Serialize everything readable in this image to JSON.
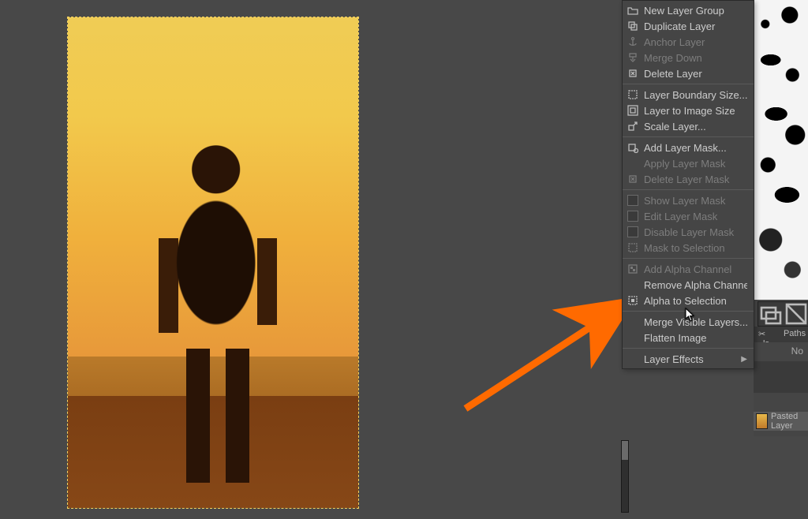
{
  "menu": {
    "new_layer_group": "New Layer Group",
    "duplicate_layer": "Duplicate Layer",
    "anchor_layer": "Anchor Layer",
    "merge_down": "Merge Down",
    "delete_layer": "Delete Layer",
    "layer_boundary_size": "Layer Boundary Size...",
    "layer_to_image_size": "Layer to Image Size",
    "scale_layer": "Scale Layer...",
    "add_layer_mask": "Add Layer Mask...",
    "apply_layer_mask": "Apply Layer Mask",
    "delete_layer_mask": "Delete Layer Mask",
    "show_layer_mask": "Show Layer Mask",
    "edit_layer_mask": "Edit Layer Mask",
    "disable_layer_mask": "Disable Layer Mask",
    "mask_to_selection": "Mask to Selection",
    "add_alpha_channel": "Add Alpha Channel",
    "remove_alpha_channel": "Remove Alpha Channel",
    "alpha_to_selection": "Alpha to Selection",
    "merge_visible_layers": "Merge Visible Layers...",
    "flatten_image": "Flatten Image",
    "layer_effects": "Layer Effects"
  },
  "panel": {
    "tab_ls": "ls",
    "tab_paths": "Paths",
    "mode_label": "No",
    "pasted_layer": "Pasted Layer"
  }
}
